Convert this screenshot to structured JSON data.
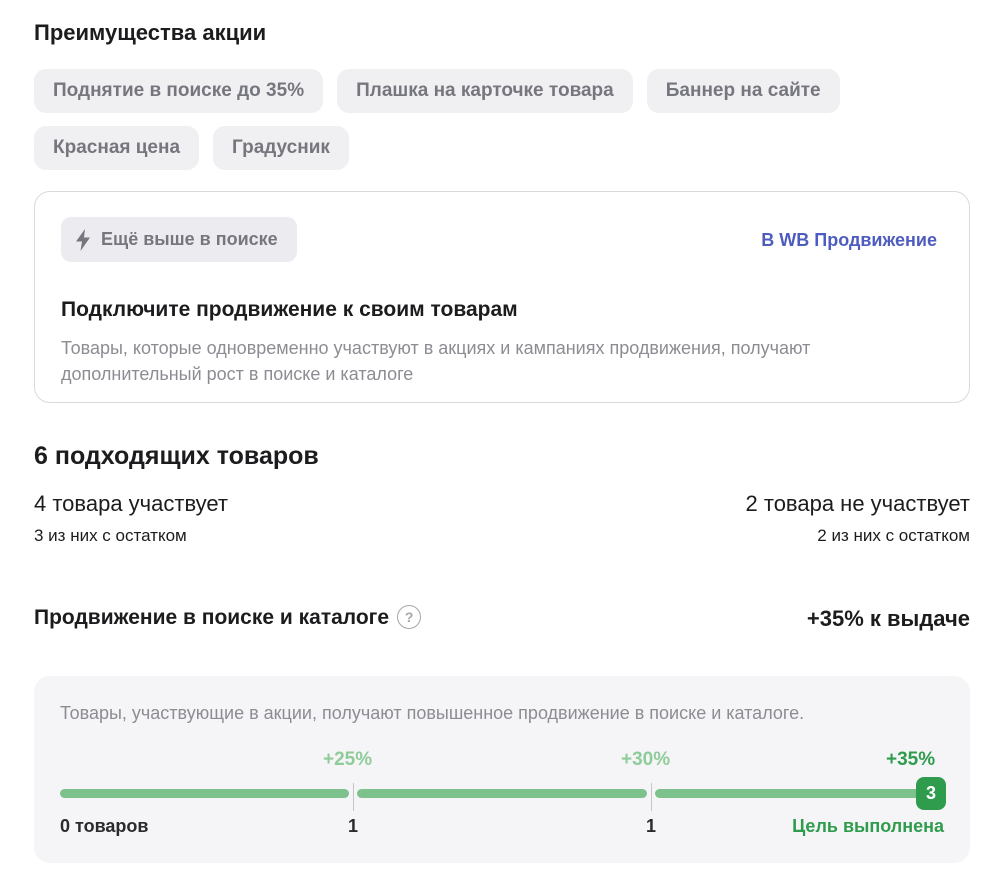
{
  "benefits": {
    "title": "Преимущества акции",
    "chips": [
      "Поднятие в поиске до 35%",
      "Плашка на карточке товара",
      "Баннер на сайте",
      "Красная цена",
      "Градусник"
    ]
  },
  "promo": {
    "tag": "Ещё выше в поиске",
    "tag_icon": "lightning-icon",
    "link": "В WB Продвижение",
    "title": "Подключите продвижение к своим товарам",
    "text": "Товары, которые одновременно участвуют в акциях и кампаниях продвижения, получают дополнительный рост в поиске и каталоге"
  },
  "products": {
    "title": "6 подходящих товаров",
    "participating": "4 товара участвует",
    "participating_sub": "3 из них с остатком",
    "not_participating": "2 товара не участвует",
    "not_participating_sub": "2 из них с остатком"
  },
  "boost": {
    "title": "Продвижение в поиске и каталоге",
    "help_icon": "question-circle-icon",
    "value": "+35% к выдаче",
    "description": "Товары, участвующие в акции, получают повышенное продвижение в поиске и каталоге.",
    "steps": [
      {
        "percent": "+25%",
        "threshold": "1"
      },
      {
        "percent": "+30%",
        "threshold": "1"
      },
      {
        "percent": "+35%",
        "threshold": "3"
      }
    ],
    "start_label": "0 товаров",
    "goal_label": "Цель выполнена",
    "progress_fraction": 1.0
  },
  "colors": {
    "accent_link": "#4e5cc0",
    "progress_green": "#7dc18d",
    "success_green": "#2f9c4d"
  }
}
